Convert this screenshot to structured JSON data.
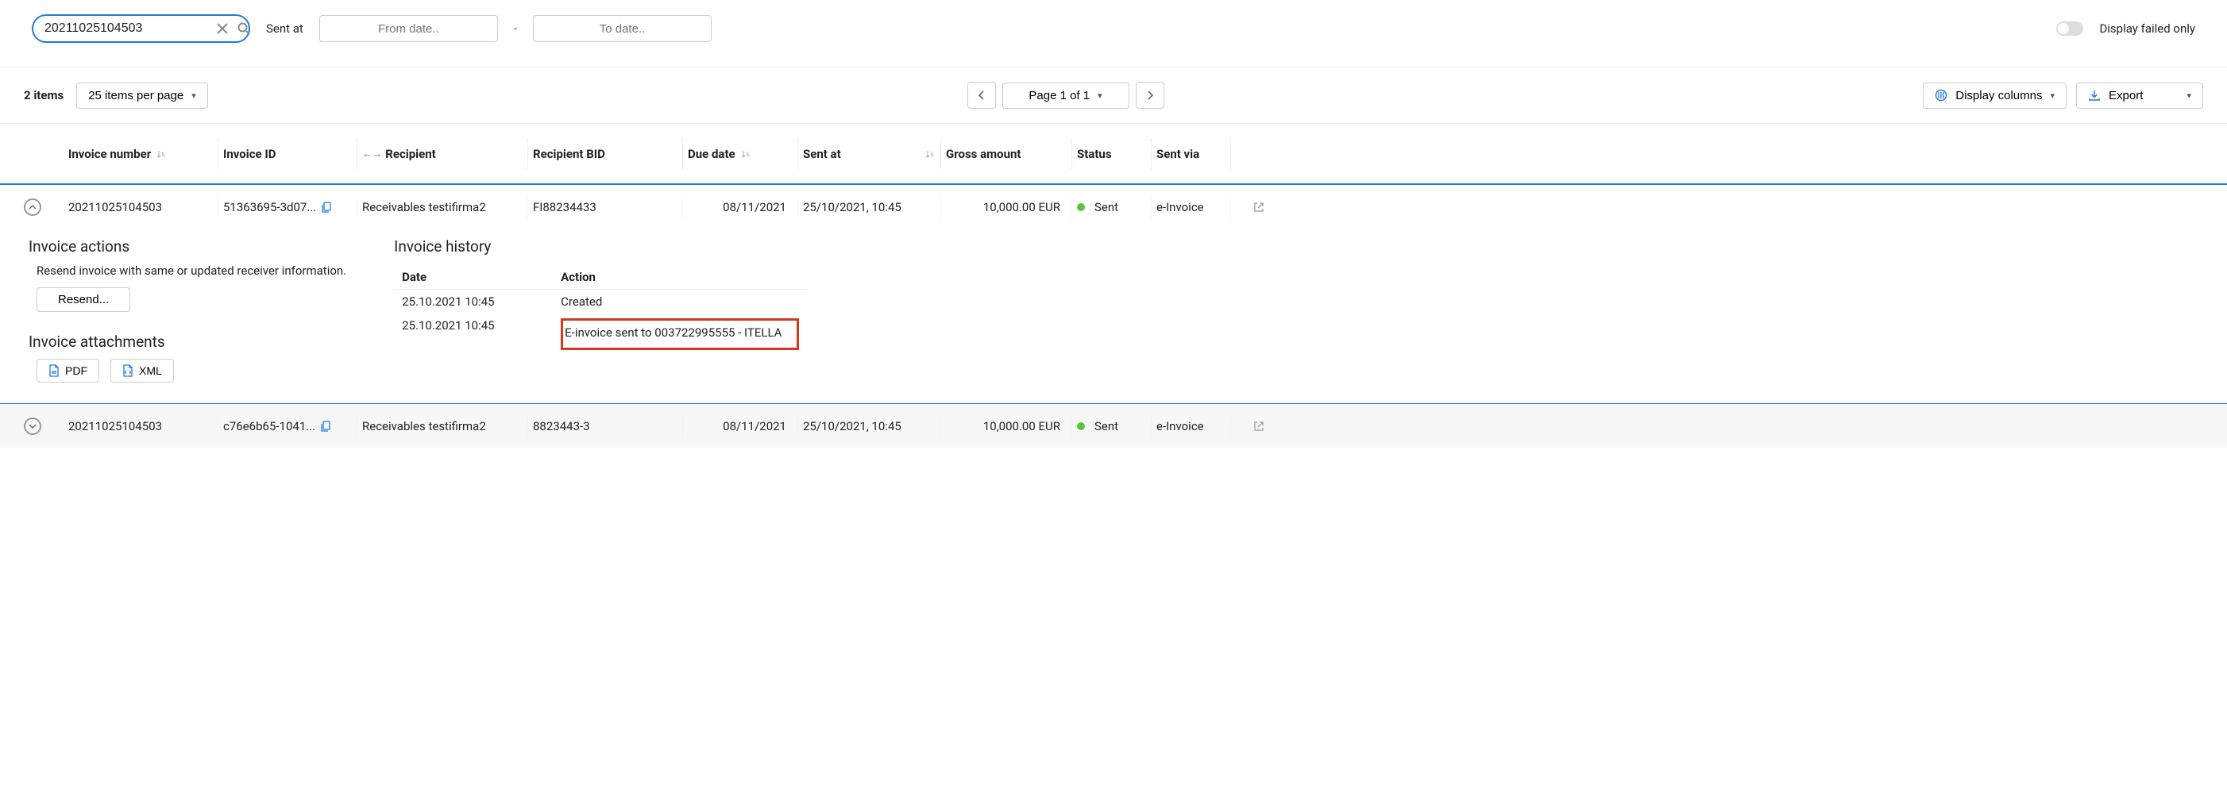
{
  "filter": {
    "search_value": "20211025104503",
    "sent_at_label": "Sent at",
    "from_placeholder": "From date..",
    "to_placeholder": "To date..",
    "dash": "-",
    "toggle_label": "Display failed only"
  },
  "toolbar": {
    "count_text": "2 items",
    "per_page": "25 items per page",
    "page_text": "Page 1 of 1",
    "display_columns": "Display columns",
    "export": "Export"
  },
  "columns": {
    "invoice_number": "Invoice number",
    "invoice_id": "Invoice ID",
    "recipient": "Recipient",
    "recipient_bid": "Recipient BID",
    "due_date": "Due date",
    "sent_at": "Sent at",
    "gross_amount": "Gross amount",
    "status": "Status",
    "sent_via": "Sent via"
  },
  "rows": [
    {
      "invoice_number": "20211025104503",
      "invoice_id": "51363695-3d07...",
      "recipient": "Receivables testifirma2",
      "recipient_bid": "FI88234433",
      "due_date": "08/11/2021",
      "sent_at": "25/10/2021, 10:45",
      "gross_amount": "10,000.00 EUR",
      "status": "Sent",
      "sent_via": "e-Invoice"
    },
    {
      "invoice_number": "20211025104503",
      "invoice_id": "c76e6b65-1041...",
      "recipient": "Receivables testifirma2",
      "recipient_bid": "8823443-3",
      "due_date": "08/11/2021",
      "sent_at": "25/10/2021, 10:45",
      "gross_amount": "10,000.00 EUR",
      "status": "Sent",
      "sent_via": "e-Invoice"
    }
  ],
  "detail": {
    "actions_title": "Invoice actions",
    "actions_desc": "Resend invoice with same or updated receiver information.",
    "resend_label": "Resend...",
    "attachments_title": "Invoice attachments",
    "pdf_label": "PDF",
    "xml_label": "XML",
    "history_title": "Invoice history",
    "history_date_h": "Date",
    "history_action_h": "Action",
    "history": [
      {
        "date": "25.10.2021 10:45",
        "action": "Created"
      },
      {
        "date": "25.10.2021 10:45",
        "action": "E-invoice sent to 003722995555 - ITELLA"
      }
    ]
  }
}
